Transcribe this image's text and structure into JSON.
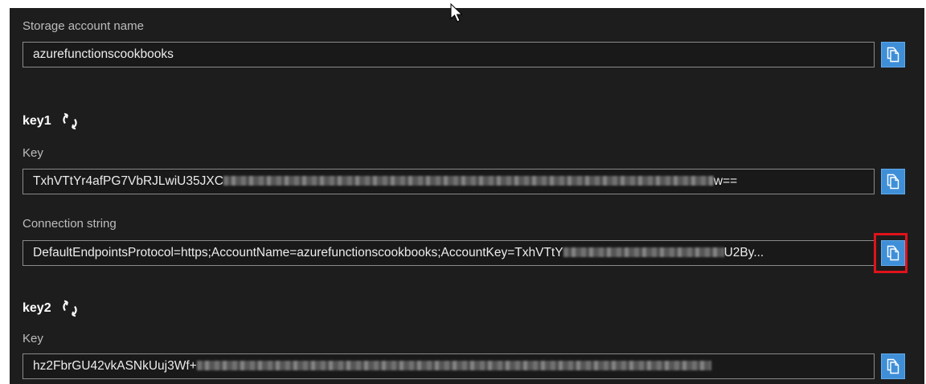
{
  "storage": {
    "label": "Storage account name",
    "value": "azurefunctionscookbooks"
  },
  "key1": {
    "title": "key1",
    "key_label": "Key",
    "key_value": "TxhVTtYr4afPG7VbRJLwiU35JXC",
    "key_value_end": "w==",
    "connection_label": "Connection string",
    "connection_value": "DefaultEndpointsProtocol=https;AccountName=azurefunctionscookbooks;AccountKey=TxhVTtY",
    "connection_value_end": "U2By..."
  },
  "key2": {
    "title": "key2",
    "key_label": "Key",
    "key_value": "hz2FbrGU42vkASNkUuj3Wf+"
  },
  "icons": {
    "copy": "copy-icon",
    "refresh": "refresh-icon",
    "cursor": "mouse-pointer-icon"
  },
  "colors": {
    "background": "#1d1d1e",
    "field_border": "#8a8a8a",
    "copy_button": "#3f8fd8",
    "highlight": "#e0121a"
  }
}
